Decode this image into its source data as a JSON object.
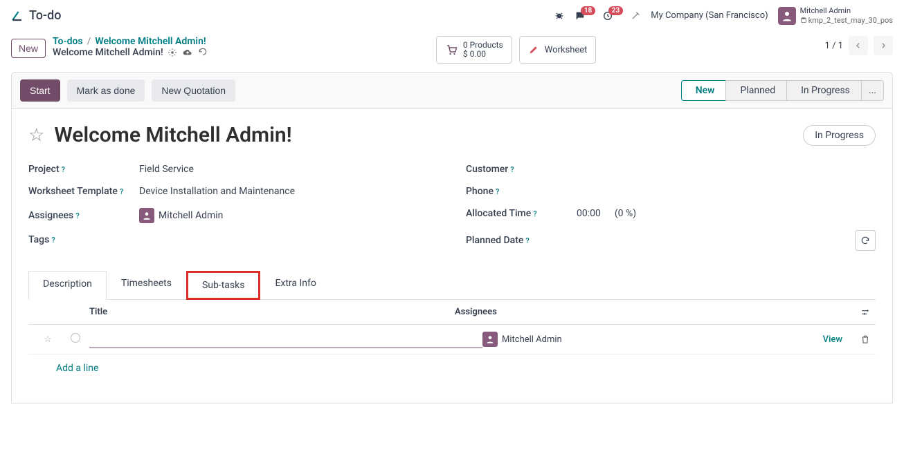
{
  "app": {
    "title": "To-do"
  },
  "topbar": {
    "chat_badge": "18",
    "activity_badge": "23",
    "company": "My Company (San Francisco)",
    "user_name": "Mitchell Admin",
    "db_name": "kmp_2_test_may_30_pos"
  },
  "header": {
    "new_label": "New",
    "crumb_root": "To-dos",
    "crumb_current": "Welcome Mitchell Admin!",
    "crumb_subtitle": "Welcome Mitchell Admin!",
    "products_line1": "0 Products",
    "products_line2": "$ 0.00",
    "worksheet_label": "Worksheet",
    "pager": "1 / 1"
  },
  "statusbar": {
    "start": "Start",
    "done": "Mark as done",
    "quote": "New Quotation",
    "stages": [
      "New",
      "Planned",
      "In Progress"
    ],
    "ellipsis": "..."
  },
  "form": {
    "title": "Welcome Mitchell Admin!",
    "status_pill": "In Progress",
    "left": {
      "project_label": "Project",
      "project_value": "Field Service",
      "ws_label": "Worksheet Template",
      "ws_value": "Device Installation and Maintenance",
      "assignees_label": "Assignees",
      "assignee_name": "Mitchell Admin",
      "tags_label": "Tags"
    },
    "right": {
      "customer_label": "Customer",
      "phone_label": "Phone",
      "alloc_label": "Allocated Time",
      "alloc_value": "00:00",
      "alloc_pct": "(0 %)",
      "planned_label": "Planned Date"
    }
  },
  "tabs": {
    "desc": "Description",
    "times": "Timesheets",
    "sub": "Sub-tasks",
    "extra": "Extra Info"
  },
  "subtable": {
    "th_title": "Title",
    "th_assignees": "Assignees",
    "row_assignee": "Mitchell Admin",
    "view": "View",
    "add_line": "Add a line"
  }
}
